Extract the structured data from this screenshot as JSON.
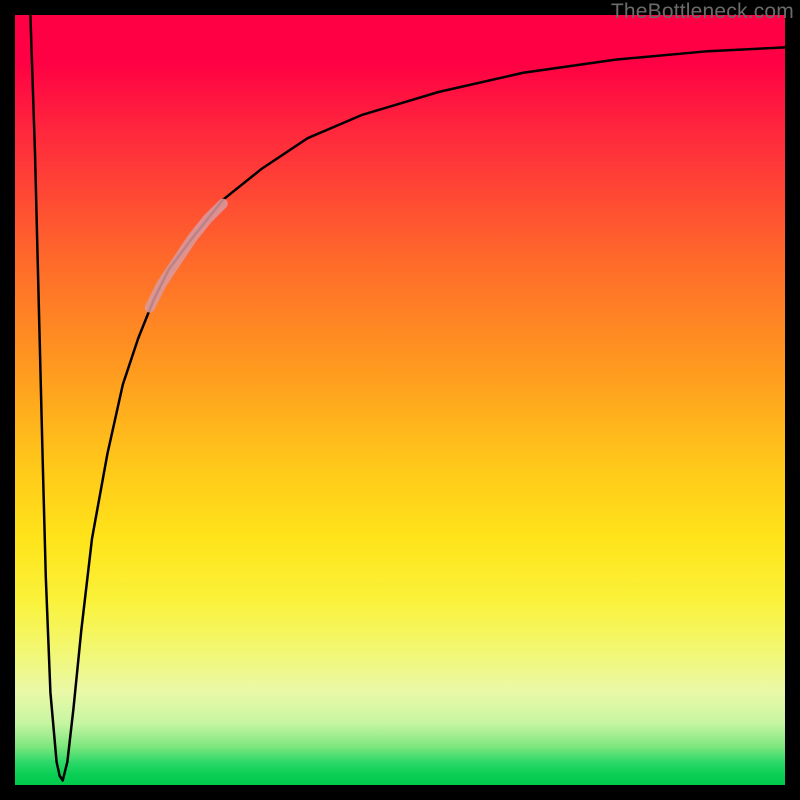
{
  "watermark": "TheBottleneck.com",
  "chart_data": {
    "type": "line",
    "title": "",
    "xlabel": "",
    "ylabel": "",
    "xlim": [
      0,
      100
    ],
    "ylim": [
      0,
      100
    ],
    "grid": false,
    "legend": false,
    "annotations": [],
    "series": [
      {
        "name": "left-spike",
        "type": "line",
        "color": "#000000",
        "x": [
          2.0,
          2.6,
          3.2,
          3.6,
          4.0,
          4.6,
          5.4,
          5.8,
          6.2
        ],
        "values": [
          100,
          82,
          58,
          42,
          27,
          12,
          3,
          1.2,
          0.6
        ]
      },
      {
        "name": "main-curve",
        "type": "line",
        "color": "#000000",
        "x": [
          5.8,
          6.2,
          6.8,
          7.6,
          8.6,
          10,
          12,
          14,
          16,
          18,
          20,
          23,
          27,
          32,
          38,
          45,
          55,
          66,
          78,
          90,
          100
        ],
        "values": [
          1.2,
          0.6,
          3,
          10,
          20,
          32,
          43,
          52,
          58,
          63,
          67,
          71,
          76,
          80,
          84,
          87,
          90,
          92.5,
          94.2,
          95.3,
          95.8
        ]
      },
      {
        "name": "highlight-segment",
        "type": "line",
        "color": "#d99aa0",
        "thick": true,
        "x": [
          17.5,
          19,
          21,
          23,
          25,
          27
        ],
        "values": [
          62,
          65,
          68,
          71,
          73.5,
          75.5
        ]
      }
    ],
    "background_gradient": {
      "top": "#ff0044",
      "mid1": "#ff9a1f",
      "mid2": "#ffe41a",
      "bottom": "#00c94d"
    }
  }
}
